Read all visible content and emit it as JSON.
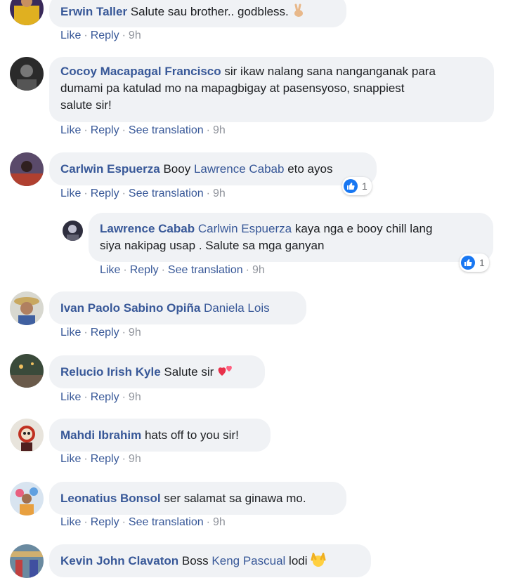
{
  "common": {
    "like": "Like",
    "reply": "Reply",
    "see_translation": "See translation",
    "separator": "·"
  },
  "colors": {
    "link": "#385898",
    "bubble": "#f0f2f5",
    "meta": "#90949c",
    "like_blue": "#1877f2"
  },
  "comments": [
    {
      "author": "Erwin Taller",
      "text": "Salute sau brother.. godbless.",
      "emoji": "victory-hand",
      "time": "9h"
    },
    {
      "author": "Cocoy Macapagal Francisco",
      "text_line1": "sir ikaw nalang sana nanganganak para",
      "text_line2": "dumami pa katulad mo na mapagbigay at pasensyoso, snappiest",
      "text_line3": "salute sir!",
      "time": "9h"
    },
    {
      "author": "Carlwin Espuerza",
      "text_before": "Booy",
      "mention": "Lawrence Cabab",
      "text_after": "eto ayos",
      "time": "9h",
      "reactions": "1"
    },
    {
      "author": "Lawrence Cabab",
      "mention": "Carlwin Espuerza",
      "text_line1": "kaya nga e booy chill lang",
      "text_line2": "siya nakipag usap . Salute sa mga ganyan",
      "time": "9h",
      "reactions": "1"
    },
    {
      "author": "Ivan Paolo Sabino Opiña",
      "mention": "Daniela Lois",
      "time": "9h"
    },
    {
      "author": "Relucio Irish Kyle",
      "text": "Salute sir",
      "emoji": "two-hearts",
      "time": "9h"
    },
    {
      "author": "Mahdi Ibrahim",
      "text": "hats off to you sir!",
      "time": "9h"
    },
    {
      "author": "Leonatius Bonsol",
      "text": "ser salamat sa ginawa mo.",
      "time": "9h"
    },
    {
      "author": "Kevin John Clavaton",
      "text_before": "Boss",
      "mention": "Keng Pascual",
      "text_after": "lodi",
      "emoji": "hands-raised"
    }
  ]
}
